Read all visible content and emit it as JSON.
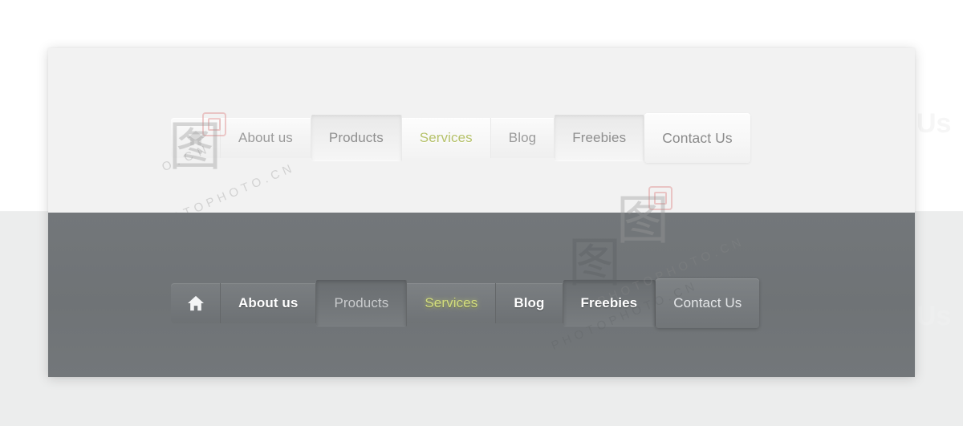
{
  "page": {
    "title": "Navigation Menu UI Kit Preview",
    "panel_light_bg": "#f2f2f2",
    "panel_dark_bg": "#71757a",
    "accent_color": "#cdd96a"
  },
  "menus": [
    {
      "id": "light-menu",
      "theme": "light",
      "items": [
        {
          "key": "home",
          "label": "",
          "icon": "home-icon",
          "state": "default"
        },
        {
          "key": "about-us",
          "label": "About us",
          "icon": null,
          "state": "default"
        },
        {
          "key": "products",
          "label": "Products",
          "icon": null,
          "state": "pressed"
        },
        {
          "key": "services",
          "label": "Services",
          "icon": null,
          "state": "active"
        },
        {
          "key": "blog",
          "label": "Blog",
          "icon": null,
          "state": "default"
        },
        {
          "key": "freebies",
          "label": "Freebies",
          "icon": null,
          "state": "pressed"
        },
        {
          "key": "contact-us",
          "label": "Contact Us",
          "icon": null,
          "state": "hover"
        }
      ]
    },
    {
      "id": "dark-menu",
      "theme": "dark",
      "items": [
        {
          "key": "home",
          "label": "",
          "icon": "home-icon",
          "state": "default"
        },
        {
          "key": "about-us",
          "label": "About us",
          "icon": null,
          "state": "bright"
        },
        {
          "key": "products",
          "label": "Products",
          "icon": null,
          "state": "pressed"
        },
        {
          "key": "services",
          "label": "Services",
          "icon": null,
          "state": "active"
        },
        {
          "key": "blog",
          "label": "Blog",
          "icon": null,
          "state": "bright"
        },
        {
          "key": "freebies",
          "label": "Freebies",
          "icon": null,
          "state": "pressed"
        },
        {
          "key": "contact-us",
          "label": "Contact Us",
          "icon": null,
          "state": "hover"
        }
      ]
    }
  ],
  "watermarks": {
    "site_text": "PHOTOPHOTO.CN",
    "short_text": "O.CN",
    "brand_glyph": "图",
    "ghost_label": "Us"
  }
}
